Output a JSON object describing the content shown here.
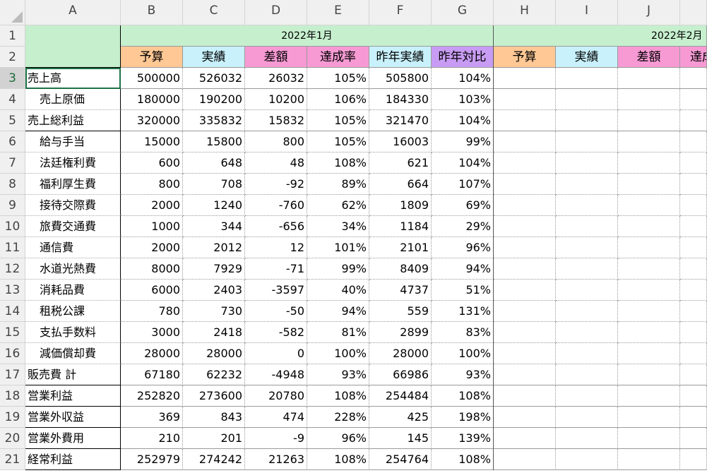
{
  "columns": [
    "A",
    "B",
    "C",
    "D",
    "E",
    "F",
    "G",
    "H",
    "I",
    "J",
    ""
  ],
  "rows": [
    "1",
    "2",
    "3",
    "4",
    "5",
    "6",
    "7",
    "8",
    "9",
    "10",
    "11",
    "12",
    "13",
    "14",
    "15",
    "16",
    "17",
    "18",
    "19",
    "20",
    "21"
  ],
  "months": [
    "2022年1月",
    "2022年2月"
  ],
  "sub_headers": [
    "予算",
    "実績",
    "差額",
    "達成率",
    "昨年実績",
    "昨年対比",
    "予算",
    "実績",
    "差額",
    "達成"
  ],
  "colors": {
    "month_header": "#c6efce",
    "budget": "#ffc894",
    "actual": "#c8f1fb",
    "diff": "#f79ad4",
    "rate": "#f79ad4",
    "last_year": "#c8f1fb",
    "yoy": "#c89cf4",
    "grid_line": "#e2e2e2",
    "active_cell": "#1e7145"
  },
  "items": [
    {
      "label": "売上高",
      "indent": false,
      "values": [
        "500000",
        "526032",
        "26032",
        "105%",
        "505800",
        "104%"
      ]
    },
    {
      "label": "売上原価",
      "indent": true,
      "values": [
        "180000",
        "190200",
        "10200",
        "106%",
        "184330",
        "103%"
      ]
    },
    {
      "label": "売上総利益",
      "indent": false,
      "values": [
        "320000",
        "335832",
        "15832",
        "105%",
        "321470",
        "104%"
      ]
    },
    {
      "label": "給与手当",
      "indent": true,
      "values": [
        "15000",
        "15800",
        "800",
        "105%",
        "16003",
        "99%"
      ]
    },
    {
      "label": "法廷権利費",
      "indent": true,
      "values": [
        "600",
        "648",
        "48",
        "108%",
        "621",
        "104%"
      ]
    },
    {
      "label": "福利厚生費",
      "indent": true,
      "values": [
        "800",
        "708",
        "-92",
        "89%",
        "664",
        "107%"
      ]
    },
    {
      "label": "接待交際費",
      "indent": true,
      "values": [
        "2000",
        "1240",
        "-760",
        "62%",
        "1809",
        "69%"
      ]
    },
    {
      "label": "旅費交通費",
      "indent": true,
      "values": [
        "1000",
        "344",
        "-656",
        "34%",
        "1184",
        "29%"
      ]
    },
    {
      "label": "通信費",
      "indent": true,
      "values": [
        "2000",
        "2012",
        "12",
        "101%",
        "2101",
        "96%"
      ]
    },
    {
      "label": "水道光熱費",
      "indent": true,
      "values": [
        "8000",
        "7929",
        "-71",
        "99%",
        "8409",
        "94%"
      ]
    },
    {
      "label": "消耗品費",
      "indent": true,
      "values": [
        "6000",
        "2403",
        "-3597",
        "40%",
        "4737",
        "51%"
      ]
    },
    {
      "label": "租税公課",
      "indent": true,
      "values": [
        "780",
        "730",
        "-50",
        "94%",
        "559",
        "131%"
      ]
    },
    {
      "label": "支払手数料",
      "indent": true,
      "values": [
        "3000",
        "2418",
        "-582",
        "81%",
        "2899",
        "83%"
      ]
    },
    {
      "label": "減価償却費",
      "indent": true,
      "values": [
        "28000",
        "28000",
        "0",
        "100%",
        "28000",
        "100%"
      ]
    },
    {
      "label": "販売費 計",
      "indent": false,
      "values": [
        "67180",
        "62232",
        "-4948",
        "93%",
        "66986",
        "93%"
      ]
    },
    {
      "label": "営業利益",
      "indent": false,
      "values": [
        "252820",
        "273600",
        "20780",
        "108%",
        "254484",
        "108%"
      ]
    },
    {
      "label": "営業外収益",
      "indent": false,
      "values": [
        "369",
        "843",
        "474",
        "228%",
        "425",
        "198%"
      ]
    },
    {
      "label": "営業外費用",
      "indent": false,
      "values": [
        "210",
        "201",
        "-9",
        "96%",
        "145",
        "139%"
      ]
    },
    {
      "label": "経常利益",
      "indent": false,
      "values": [
        "252979",
        "274242",
        "21263",
        "108%",
        "254764",
        "108%"
      ]
    }
  ]
}
